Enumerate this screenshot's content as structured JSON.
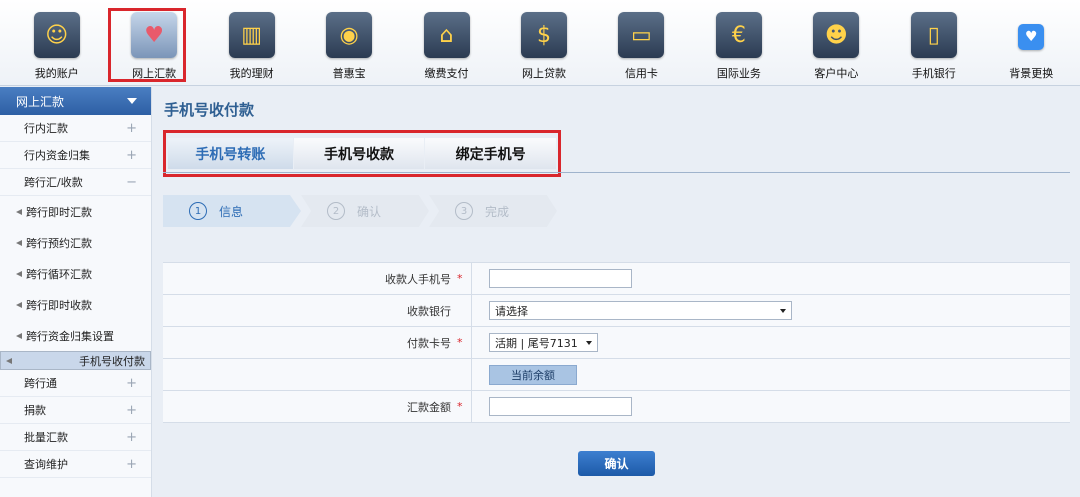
{
  "topnav": {
    "items": [
      {
        "label": "我的账户",
        "icon": "user-account-icon",
        "glyph": "☺"
      },
      {
        "label": "网上汇款",
        "icon": "remittance-icon",
        "glyph": "♥"
      },
      {
        "label": "我的理财",
        "icon": "finance-icon",
        "glyph": "▥"
      },
      {
        "label": "普惠宝",
        "icon": "money-bag-icon",
        "glyph": "◉"
      },
      {
        "label": "缴费支付",
        "icon": "house-icon",
        "glyph": "⌂"
      },
      {
        "label": "网上贷款",
        "icon": "loan-icon",
        "glyph": "$"
      },
      {
        "label": "信用卡",
        "icon": "credit-card-icon",
        "glyph": "▭"
      },
      {
        "label": "国际业务",
        "icon": "currency-icon",
        "glyph": "€"
      },
      {
        "label": "客户中心",
        "icon": "customer-icon",
        "glyph": "☻"
      },
      {
        "label": "手机银行",
        "icon": "mobile-icon",
        "glyph": "▯"
      },
      {
        "label": "背景更换",
        "icon": "heart-icon",
        "glyph": "♥"
      }
    ]
  },
  "sidebar": {
    "header": "网上汇款",
    "rows": [
      {
        "label": "行内汇款",
        "pm": "+"
      },
      {
        "label": "行内资金归集",
        "pm": "+"
      },
      {
        "label": "跨行汇/收款",
        "pm": "−"
      }
    ],
    "subs": [
      {
        "label": "跨行即时汇款"
      },
      {
        "label": "跨行预约汇款"
      },
      {
        "label": "跨行循环汇款"
      },
      {
        "label": "跨行即时收款"
      },
      {
        "label": "跨行资金归集设置"
      },
      {
        "label": "手机号收付款"
      }
    ],
    "rows2": [
      {
        "label": "跨行通",
        "pm": "+"
      },
      {
        "label": "捐款",
        "pm": "+"
      },
      {
        "label": "批量汇款",
        "pm": "+"
      },
      {
        "label": "查询维护",
        "pm": "+"
      }
    ]
  },
  "main": {
    "title": "手机号收付款",
    "tabs": [
      {
        "label": "手机号转账"
      },
      {
        "label": "手机号收款"
      },
      {
        "label": "绑定手机号"
      }
    ],
    "steps": [
      {
        "num": "1",
        "label": "信息"
      },
      {
        "num": "2",
        "label": "确认"
      },
      {
        "num": "3",
        "label": "完成"
      }
    ],
    "form": {
      "phone_label": "收款人手机号",
      "bank_label": "收款银行",
      "bank_value": "请选择",
      "card_label": "付款卡号",
      "card_value": "活期 | 尾号7131",
      "balance_button": "当前余额",
      "amount_label": "汇款金额",
      "required_mark": "*"
    },
    "confirm_button": "确认"
  },
  "colors": {
    "accent": "#2d6cb5",
    "highlight": "#d9262c"
  }
}
